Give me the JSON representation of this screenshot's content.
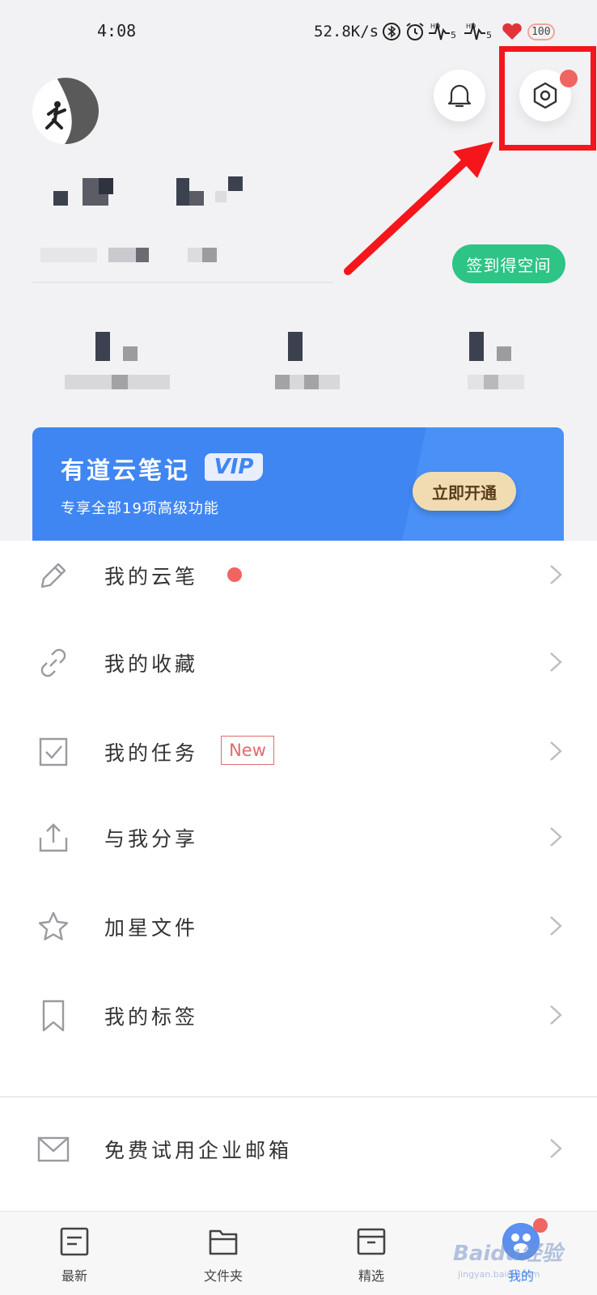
{
  "status_bar": {
    "time": "4:08",
    "net_speed": "52.8K/s",
    "battery": "100",
    "signal_hd": "HD",
    "signal_5": "5"
  },
  "header": {
    "checkin_label": "签到得空间"
  },
  "vip_banner": {
    "title": "有道云笔记",
    "badge": "VIP",
    "subtitle": "专享全部19项高级功能",
    "button_label": "立即开通"
  },
  "menu": {
    "items": [
      {
        "label": "我的云笔"
      },
      {
        "label": "我的收藏"
      },
      {
        "label": "我的任务",
        "badge": "New"
      },
      {
        "label": "与我分享"
      },
      {
        "label": "加星文件"
      },
      {
        "label": "我的标签"
      },
      {
        "label": "免费试用企业邮箱"
      }
    ]
  },
  "bottom_nav": {
    "items": [
      {
        "label": "最新"
      },
      {
        "label": "文件夹"
      },
      {
        "label": "精选"
      },
      {
        "label": "我的"
      }
    ]
  },
  "watermark": {
    "text": "Baidu经验",
    "sub": "jingyan.baidu.com"
  },
  "colors": {
    "accent_green": "#2ec486",
    "vip_blue": "#3f86f3",
    "notify_red": "#f06462",
    "annotation_red": "#f4161b"
  }
}
